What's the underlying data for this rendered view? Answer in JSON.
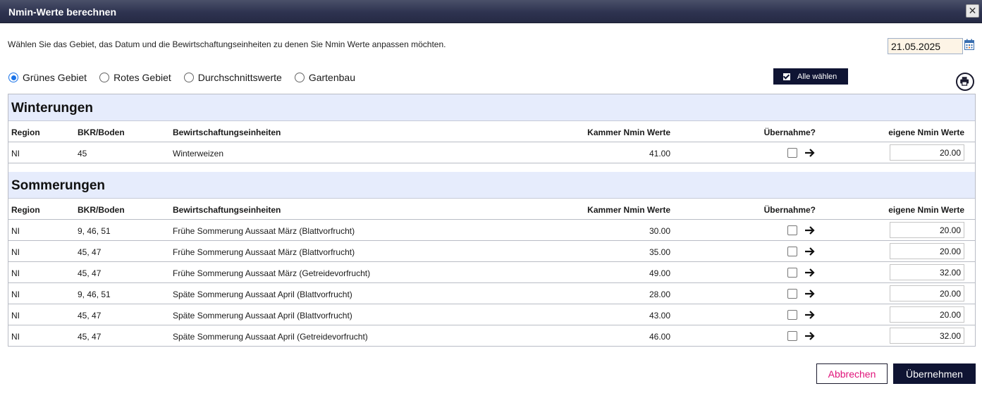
{
  "dialog": {
    "title": "Nmin-Werte berechnen",
    "close_label": "✕"
  },
  "instruction": "Wählen Sie das Gebiet, das Datum und die Bewirtschaftungseinheiten zu denen Sie Nmin Werte anpassen möchten.",
  "date": {
    "value": "21.05.2025",
    "icon": "calendar-icon"
  },
  "area_options": [
    {
      "label": "Grünes Gebiet",
      "selected": true
    },
    {
      "label": "Rotes Gebiet",
      "selected": false
    },
    {
      "label": "Durchschnittswerte",
      "selected": false
    },
    {
      "label": "Gartenbau",
      "selected": false
    }
  ],
  "select_all_label": "Alle wählen",
  "print_icon": "printer-icon",
  "columns": {
    "region": "Region",
    "bkr": "BKR/Boden",
    "bew": "Bewirtschaftungseinheiten",
    "kammer": "Kammer Nmin Werte",
    "uebernahme": "Übernahme?",
    "eigene": "eigene Nmin Werte"
  },
  "sections": [
    {
      "title": "Winterungen",
      "rows": [
        {
          "region": "NI",
          "bkr": "45",
          "bew": "Winterweizen",
          "kammer": "41.00",
          "eigene": "20.00"
        }
      ]
    },
    {
      "title": "Sommerungen",
      "rows": [
        {
          "region": "NI",
          "bkr": "9, 46, 51",
          "bew": "Frühe Sommerung Aussaat März (Blattvorfrucht)",
          "kammer": "30.00",
          "eigene": "20.00"
        },
        {
          "region": "NI",
          "bkr": "45, 47",
          "bew": "Frühe Sommerung Aussaat März (Blattvorfrucht)",
          "kammer": "35.00",
          "eigene": "20.00"
        },
        {
          "region": "NI",
          "bkr": "45, 47",
          "bew": "Frühe Sommerung Aussaat März (Getreidevorfrucht)",
          "kammer": "49.00",
          "eigene": "32.00"
        },
        {
          "region": "NI",
          "bkr": "9, 46, 51",
          "bew": "Späte Sommerung Aussaat April (Blattvorfrucht)",
          "kammer": "28.00",
          "eigene": "20.00"
        },
        {
          "region": "NI",
          "bkr": "45, 47",
          "bew": "Späte Sommerung Aussaat April (Blattvorfrucht)",
          "kammer": "43.00",
          "eigene": "20.00"
        },
        {
          "region": "NI",
          "bkr": "45, 47",
          "bew": "Späte Sommerung Aussaat April (Getreidevorfrucht)",
          "kammer": "46.00",
          "eigene": "32.00"
        }
      ]
    }
  ],
  "buttons": {
    "cancel": "Abbrechen",
    "ok": "Übernehmen"
  },
  "colors": {
    "titlebar": "#2e3350",
    "primary": "#0f1433",
    "section_bg": "#e6ecfc",
    "cancel_text": "#e0137a",
    "radio_accent": "#1a73e8"
  }
}
